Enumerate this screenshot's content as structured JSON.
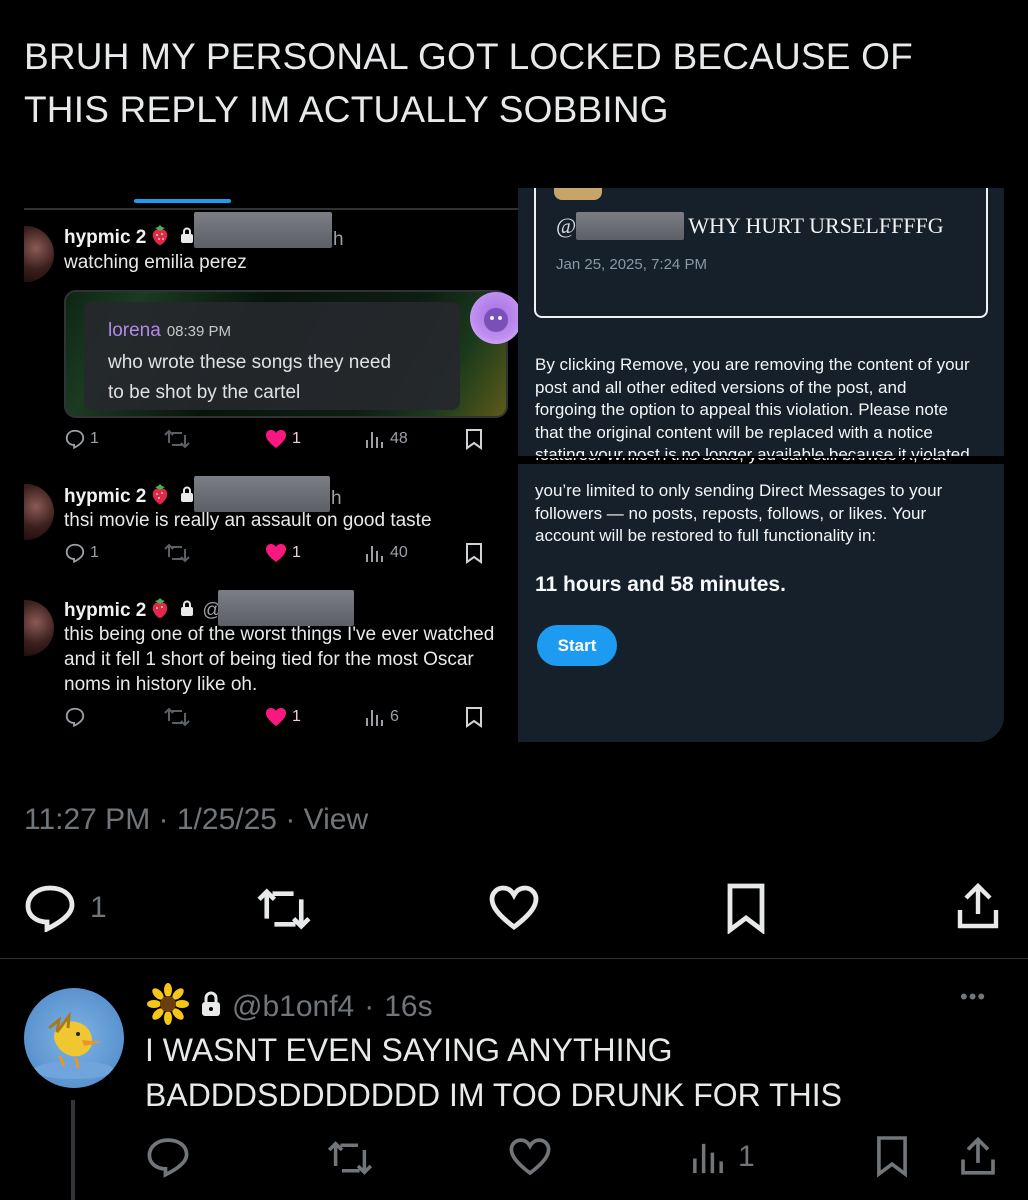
{
  "post": {
    "text_line1": "BRUH MY PERSONAL GOT LOCKED BECAUSE OF",
    "text_line2": "THIS REPLY IM ACTUALLY SOBBING",
    "timestamp_time": "11:27 PM",
    "timestamp_date": "1/25/25",
    "views_label": "View",
    "separator": "·",
    "reply_count": "1"
  },
  "left_screenshot": {
    "replies": [
      {
        "name": "hypmic 2",
        "time_suffix": "h",
        "text": "watching emilia perez",
        "quote": {
          "name": "lorena",
          "time": "08:39 PM",
          "line1": "who wrote these songs they need",
          "line2": "to be shot by the cartel"
        },
        "comments": "1",
        "likes": "1",
        "views": "48"
      },
      {
        "name": "hypmic 2",
        "time_suffix": "h",
        "text": "thsi movie is really an assault on good taste",
        "comments": "1",
        "likes": "1",
        "views": "40"
      },
      {
        "name": "hypmic 2",
        "at": "@",
        "line1": "this being one of the worst things I've ever watched",
        "line2": "and it fell 1 short of being tied for the most Oscar",
        "line3": "noms in history like oh.",
        "likes": "1",
        "views": "6"
      }
    ]
  },
  "right_screenshot": {
    "at": "@",
    "quoted_text": "WHY HURT URSELFFFFG",
    "date": "Jan 25, 2025, 7:24 PM",
    "para1": [
      "By clicking Remove, you are removing the content of your",
      "post and all other edited versions of the post, and",
      "forgoing the option to appeal this violation. Please note",
      "that the original content will be replaced with a notice",
      "stating your post is no longer available because it violated"
    ],
    "cut_line": "features. While in this state, you can still browse X, but",
    "para2": [
      "you’re limited to only sending Direct Messages to your",
      "followers — no posts, reposts, follows, or likes. Your",
      "account will be restored to full functionality in:"
    ],
    "countdown": "11 hours and 58 minutes.",
    "start_label": "Start"
  },
  "reply": {
    "handle": "@b1onf4",
    "separator": "·",
    "age": "16s",
    "line1": "I WASNT EVEN SAYING ANYTHING",
    "line2": "BADDDSDDDDDDD IM TOO DRUNK FOR THIS",
    "views": "1",
    "more_label": "•••"
  },
  "colors": {
    "accent": "#1d9bf0",
    "muted": "#71767b",
    "like_pink": "#f91880",
    "panel": "#15202b"
  }
}
